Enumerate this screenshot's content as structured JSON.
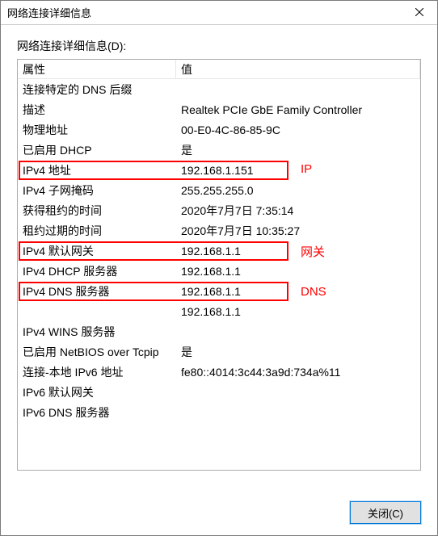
{
  "window": {
    "title": "网络连接详细信息"
  },
  "section_label": "网络连接详细信息(D):",
  "headers": {
    "property": "属性",
    "value": "值"
  },
  "rows": [
    {
      "prop": "连接特定的 DNS 后缀",
      "val": ""
    },
    {
      "prop": "描述",
      "val": "Realtek PCIe GbE Family Controller"
    },
    {
      "prop": "物理地址",
      "val": "00-E0-4C-86-85-9C"
    },
    {
      "prop": "已启用 DHCP",
      "val": "是"
    },
    {
      "prop": "IPv4 地址",
      "val": "192.168.1.151"
    },
    {
      "prop": "IPv4 子网掩码",
      "val": "255.255.255.0"
    },
    {
      "prop": "获得租约的时间",
      "val": "2020年7月7日 7:35:14"
    },
    {
      "prop": "租约过期的时间",
      "val": "2020年7月7日 10:35:27"
    },
    {
      "prop": "IPv4 默认网关",
      "val": "192.168.1.1"
    },
    {
      "prop": "IPv4 DHCP 服务器",
      "val": "192.168.1.1"
    },
    {
      "prop": "IPv4 DNS 服务器",
      "val": "192.168.1.1"
    },
    {
      "prop": "",
      "val": "192.168.1.1"
    },
    {
      "prop": "IPv4 WINS 服务器",
      "val": ""
    },
    {
      "prop": "已启用 NetBIOS over Tcpip",
      "val": "是"
    },
    {
      "prop": "连接-本地 IPv6 地址",
      "val": "fe80::4014:3c44:3a9d:734a%11"
    },
    {
      "prop": "IPv6 默认网关",
      "val": ""
    },
    {
      "prop": "IPv6 DNS 服务器",
      "val": ""
    }
  ],
  "annotations": {
    "ip": "IP",
    "gateway": "网关",
    "dns": "DNS"
  },
  "footer": {
    "close": "关闭(C)"
  }
}
